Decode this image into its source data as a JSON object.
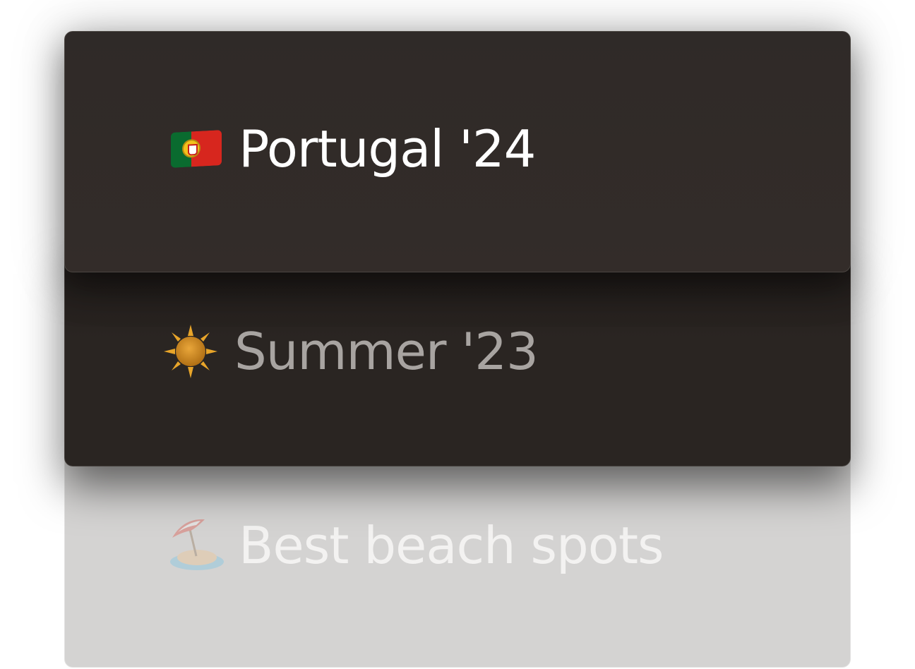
{
  "list": {
    "items": [
      {
        "label": "Portugal '24",
        "icon": "portugal-flag-icon"
      },
      {
        "label": "Summer '23",
        "icon": "sun-icon"
      },
      {
        "label": "Best beach spots",
        "icon": "beach-umbrella-icon"
      }
    ]
  },
  "colors": {
    "front_card": "#332c29",
    "middle_card": "#2a2522",
    "back_card": "#d4d3d2",
    "front_text": "#ffffff",
    "middle_text": "#a8a4a1",
    "back_text": "#f3f2f1"
  }
}
